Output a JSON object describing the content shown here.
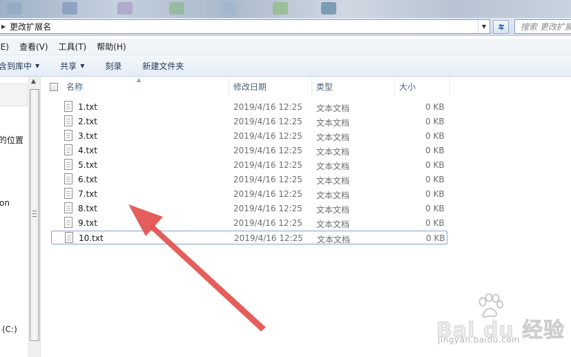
{
  "address": {
    "path": "更改扩展名",
    "search_placeholder": "搜索 更改扩展名"
  },
  "menu": [
    "(E)",
    "查看(V)",
    "工具(T)",
    "帮助(H)"
  ],
  "commands": [
    {
      "label": "含到库中",
      "dropdown": true
    },
    {
      "label": "共享",
      "dropdown": true
    },
    {
      "label": "刻录",
      "dropdown": false
    },
    {
      "label": "新建文件夹",
      "dropdown": false
    }
  ],
  "nav": {
    "items": [
      "的位置",
      "on",
      "(C:)"
    ]
  },
  "columns": {
    "name": "名称",
    "modified": "修改日期",
    "type": "类型",
    "size": "大小"
  },
  "files": [
    {
      "name": "1.txt",
      "modified": "2019/4/16 12:25",
      "type": "文本文档",
      "size": "0 KB"
    },
    {
      "name": "2.txt",
      "modified": "2019/4/16 12:25",
      "type": "文本文档",
      "size": "0 KB"
    },
    {
      "name": "3.txt",
      "modified": "2019/4/16 12:25",
      "type": "文本文档",
      "size": "0 KB"
    },
    {
      "name": "4.txt",
      "modified": "2019/4/16 12:25",
      "type": "文本文档",
      "size": "0 KB"
    },
    {
      "name": "5.txt",
      "modified": "2019/4/16 12:25",
      "type": "文本文档",
      "size": "0 KB"
    },
    {
      "name": "6.txt",
      "modified": "2019/4/16 12:25",
      "type": "文本文档",
      "size": "0 KB"
    },
    {
      "name": "7.txt",
      "modified": "2019/4/16 12:25",
      "type": "文本文档",
      "size": "0 KB"
    },
    {
      "name": "8.txt",
      "modified": "2019/4/16 12:25",
      "type": "文本文档",
      "size": "0 KB"
    },
    {
      "name": "9.txt",
      "modified": "2019/4/16 12:25",
      "type": "文本文档",
      "size": "0 KB"
    },
    {
      "name": "10.txt",
      "modified": "2019/4/16 12:25",
      "type": "文本文档",
      "size": "0 KB",
      "selected": true
    }
  ],
  "watermark": {
    "brand": "Bai du 经验",
    "url": "jingyan.baidu.com"
  },
  "colors": {
    "annotation_arrow": "#e2504d",
    "selection_border": "#7da2ce",
    "command_text": "#1e3958"
  }
}
